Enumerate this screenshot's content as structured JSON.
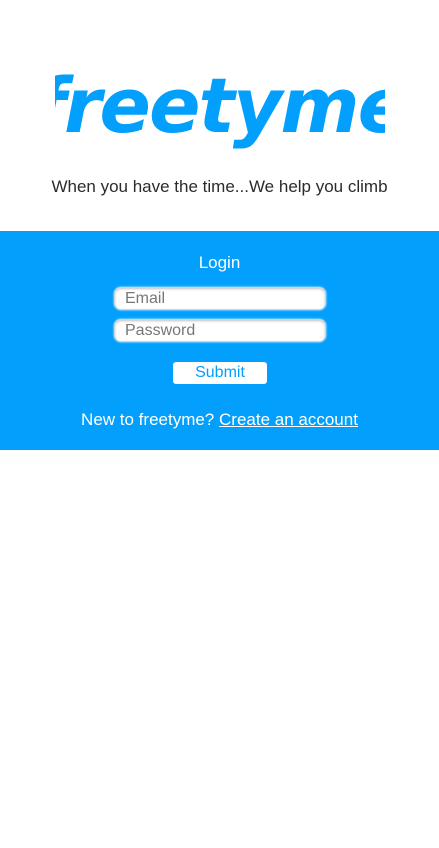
{
  "brand": {
    "logo_text": "freetyme",
    "logo_color": "#029ffd",
    "tagline": "When you have the time...We help you climb"
  },
  "login": {
    "title": "Login",
    "email_placeholder": "Email",
    "password_placeholder": "Password",
    "submit_label": "Submit",
    "signup_prompt": "New to freetyme?",
    "signup_link": "Create an account",
    "panel_color": "#029ffd"
  }
}
